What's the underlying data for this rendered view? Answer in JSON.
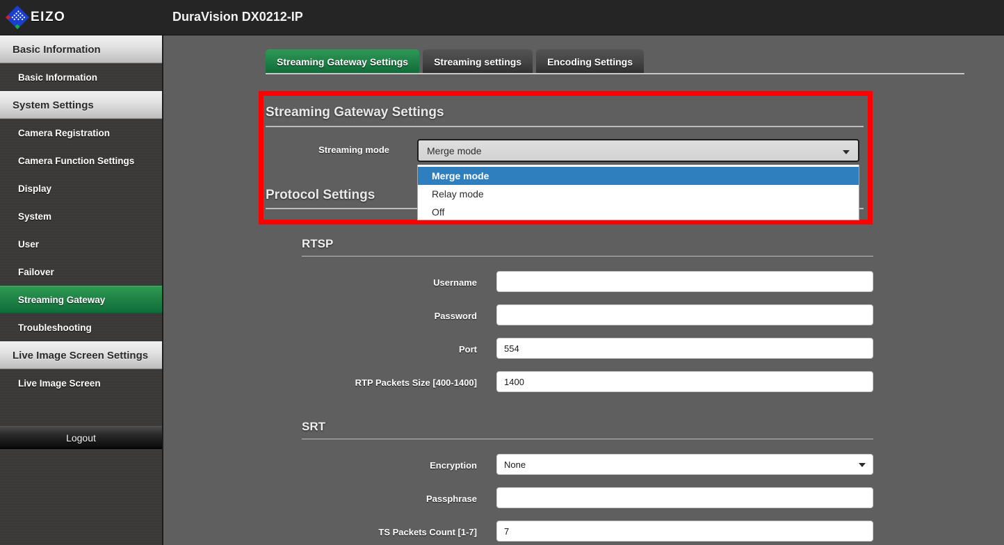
{
  "topbar": {
    "brand": "EIZO",
    "brand_icon": "eizo-diamond-logo",
    "app_title": "DuraVision DX0212-IP"
  },
  "sidebar": {
    "items": [
      {
        "label": "Basic Information",
        "type": "group"
      },
      {
        "label": "Basic Information",
        "type": "item"
      },
      {
        "label": "System Settings",
        "type": "group"
      },
      {
        "label": "Camera Registration",
        "type": "item"
      },
      {
        "label": "Camera Function Settings",
        "type": "item"
      },
      {
        "label": "Display",
        "type": "item"
      },
      {
        "label": "System",
        "type": "item"
      },
      {
        "label": "User",
        "type": "item"
      },
      {
        "label": "Failover",
        "type": "item"
      },
      {
        "label": "Streaming Gateway",
        "type": "item",
        "selected": true
      },
      {
        "label": "Troubleshooting",
        "type": "item"
      },
      {
        "label": "Live Image Screen Settings",
        "type": "group"
      },
      {
        "label": "Live Image Screen",
        "type": "item"
      }
    ],
    "logout_label": "Logout",
    "selected_color": "#1f8246"
  },
  "tabs": [
    {
      "label": "Streaming Gateway Settings",
      "active": true
    },
    {
      "label": "Streaming settings",
      "active": false
    },
    {
      "label": "Encoding Settings",
      "active": false
    }
  ],
  "main": {
    "gateway_section_title": "Streaming Gateway Settings",
    "streaming_mode_label": "Streaming mode",
    "streaming_mode_value": "Merge mode",
    "streaming_mode_options": [
      "Merge mode",
      "Relay mode",
      "Off"
    ],
    "streaming_mode_selected": "Merge mode",
    "protocol_section_title": "Protocol Settings",
    "rtsp": {
      "title": "RTSP",
      "fields": [
        {
          "label": "Username",
          "value": ""
        },
        {
          "label": "Password",
          "value": ""
        },
        {
          "label": "Port",
          "value": "554"
        },
        {
          "label": "RTP Packets Size [400-1400]",
          "value": "1400"
        }
      ]
    },
    "srt": {
      "title": "SRT",
      "encryption_label": "Encryption",
      "encryption_value": "None",
      "passphrase_label": "Passphrase",
      "passphrase_value": "",
      "ts_packets_label": "TS Packets Count [1-7]",
      "ts_packets_value": "7"
    }
  },
  "annotation": {
    "highlight_color": "#fe0000",
    "dropdown_highlight_color": "#2f7fbf"
  }
}
